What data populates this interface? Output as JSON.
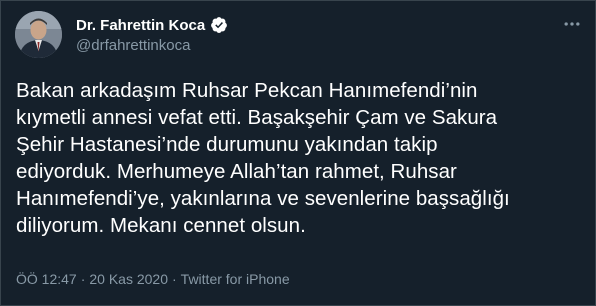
{
  "author": {
    "name": "Dr. Fahrettin Koca",
    "handle": "@drfahrettinkoca",
    "verified_icon": "verified-badge-icon",
    "avatar_icon": "profile-avatar"
  },
  "menu_icon": "more-options-icon",
  "tweet": {
    "lines": [
      "Bakan arkadaşım Ruhsar Pekcan Hanımefendi’nin",
      "kıymetli annesi vefat etti. Başakşehir Çam ve Sakura",
      "Şehir Hastanesi’nde durumunu yakından takip",
      "ediyorduk. Merhumeye Allah’tan rahmet, Ruhsar",
      "Hanımefendi’ye, yakınlarına ve sevenlerine başsağlığı",
      "diliyorum. Mekanı cennet olsun."
    ]
  },
  "meta": {
    "time": "ÖÖ 12:47",
    "separator1": "·",
    "date": "20 Kas 2020",
    "separator2": "·",
    "source": "Twitter for iPhone"
  },
  "colors": {
    "background": "#15202b",
    "text": "#ffffff",
    "secondary": "#8899a6",
    "verified": "#1da1f2"
  }
}
